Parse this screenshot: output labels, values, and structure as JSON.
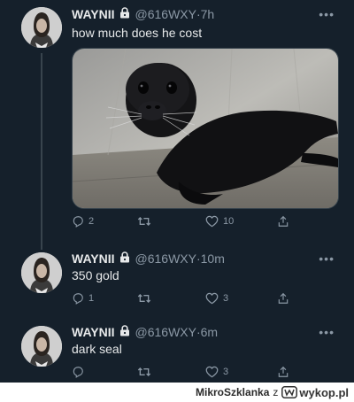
{
  "tweets": [
    {
      "name": "WAYNII",
      "handle": "@616WXY",
      "time": "7h",
      "text": "how much does he cost",
      "has_media": true,
      "replies": "2",
      "retweets": "",
      "likes": "10"
    },
    {
      "name": "WAYNII",
      "handle": "@616WXY",
      "time": "10m",
      "text": "350 gold",
      "has_media": false,
      "replies": "1",
      "retweets": "",
      "likes": "3"
    },
    {
      "name": "WAYNII",
      "handle": "@616WXY",
      "time": "6m",
      "text": "dark seal",
      "has_media": false,
      "replies": "",
      "retweets": "",
      "likes": "3"
    }
  ],
  "separator": "·",
  "footer": {
    "user": "MikroSzklanka",
    "conj": "z",
    "site": "wykop.pl"
  },
  "colors": {
    "background": "#15202b",
    "secondary_text": "#8b98a5",
    "thread_line": "#38444d"
  }
}
